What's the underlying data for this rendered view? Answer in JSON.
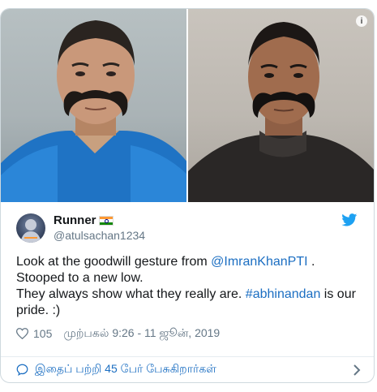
{
  "tweet": {
    "display_name": "Runner",
    "handle": "@atulsachan1234",
    "text_before_mention": "Look at the goodwill gesture from ",
    "mention": "@ImranKhanPTI",
    "text_after_mention": " .",
    "line2": "Stooped to a new low.",
    "line3_before_hashtag": "They always show what they really are. ",
    "hashtag": "#abhinandan",
    "line3_after_hashtag": " is our pride. :)",
    "like_count": "105",
    "timestamp": "முற்பகல் 9:26 - 11 ஜூன், 2019"
  },
  "footer": {
    "conversation_text": "இதைப் பற்றி 45 பேர் பேசுகிறார்கள்"
  },
  "icons": {
    "info": "info-icon",
    "bird": "twitter-bird-icon",
    "heart": "heart-icon",
    "bubble": "comment-bubble-icon",
    "chevron": "chevron-right-icon"
  },
  "colors": {
    "link": "#1b6ec2",
    "twitter_blue": "#1da1f2",
    "muted": "#657786",
    "text": "#14171a"
  }
}
